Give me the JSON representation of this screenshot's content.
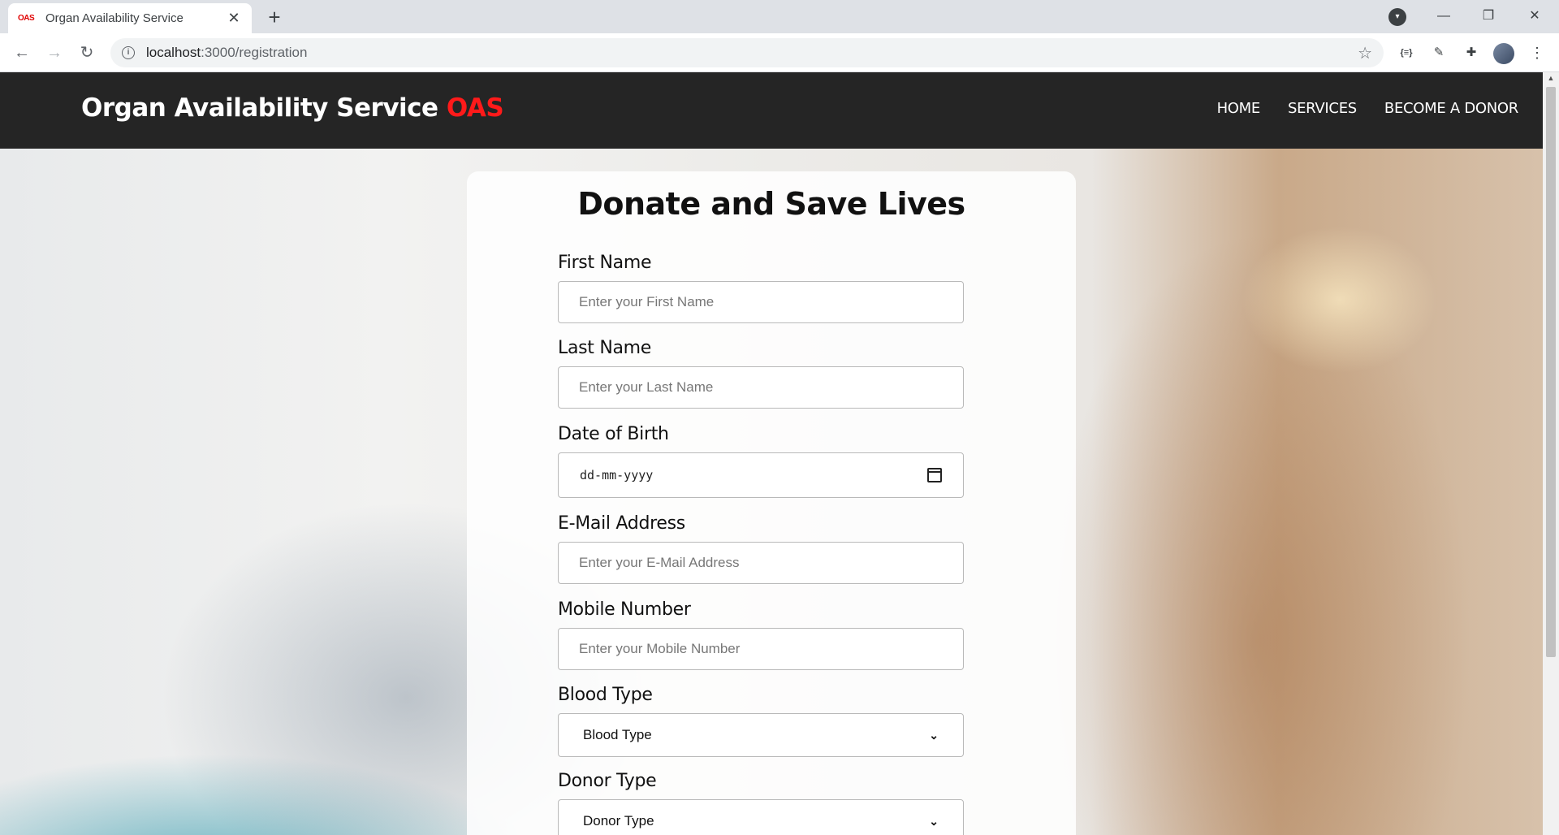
{
  "browser": {
    "tab_title": "Organ Availability Service",
    "favicon_text": "OAS",
    "url_host": "localhost",
    "url_path": ":3000/registration"
  },
  "navbar": {
    "brand_main": "Organ Availability Service",
    "brand_accent": "OAS",
    "links": [
      "HOME",
      "SERVICES",
      "BECOME A DONOR"
    ]
  },
  "form": {
    "title": "Donate and Save Lives",
    "first_name": {
      "label": "First Name",
      "placeholder": "Enter your First Name"
    },
    "last_name": {
      "label": "Last Name",
      "placeholder": "Enter your Last Name"
    },
    "dob": {
      "label": "Date of Birth",
      "format": "dd-mm-yyyy"
    },
    "email": {
      "label": "E-Mail Address",
      "placeholder": "Enter your E-Mail Address"
    },
    "mobile": {
      "label": "Mobile Number",
      "placeholder": "Enter your Mobile Number"
    },
    "blood_type": {
      "label": "Blood Type",
      "selected": "Blood Type"
    },
    "donor_type": {
      "label": "Donor Type",
      "selected": "Donor Type"
    }
  },
  "colors": {
    "navbar_bg": "#252525",
    "brand_accent": "#ff1a1a"
  }
}
